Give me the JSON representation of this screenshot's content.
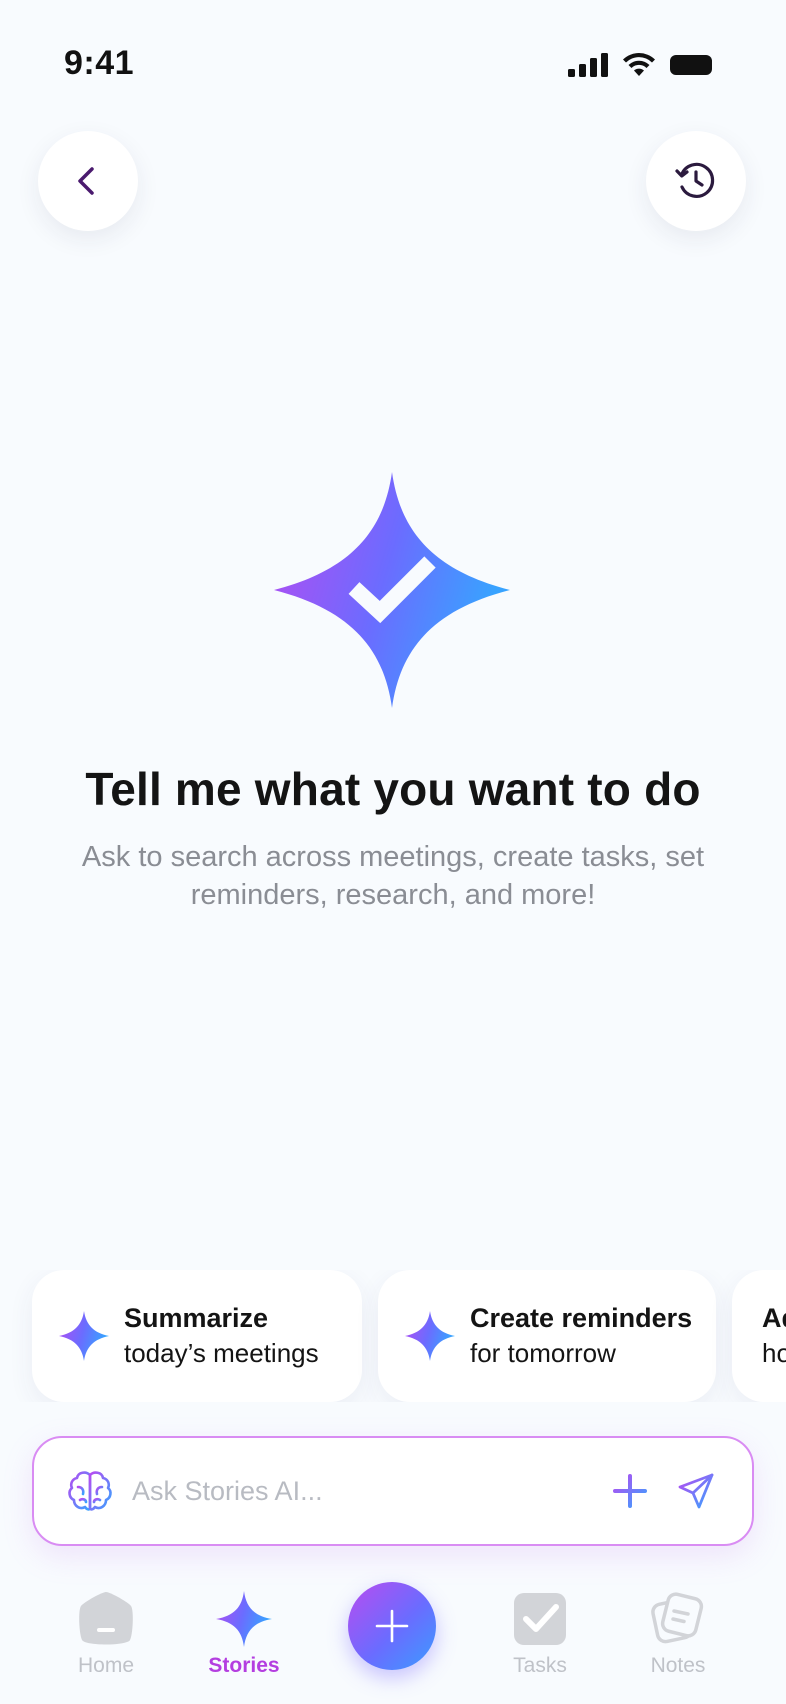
{
  "status_bar": {
    "time": "9:41"
  },
  "header": {
    "back_icon": "chevron-left-icon",
    "history_icon": "history-clock-icon"
  },
  "hero": {
    "logo_icon": "sparkle-check-icon",
    "headline": "Tell me what you want to do",
    "subtext": "Ask to search across meetings, create tasks, set reminders, research, and more!"
  },
  "suggestions": [
    {
      "title": "Summarize",
      "subtitle": "today’s meetings",
      "icon": "sparkle-icon"
    },
    {
      "title": "Create reminders",
      "subtitle": "for tomorrow",
      "icon": "sparkle-icon"
    },
    {
      "title": "Ad",
      "subtitle": "ho",
      "icon": ""
    }
  ],
  "ask_bar": {
    "placeholder": "Ask Stories AI...",
    "icons": [
      "brain-icon",
      "plus-icon",
      "send-icon"
    ]
  },
  "tabbar": {
    "items": [
      {
        "label": "Home",
        "icon": "home-icon",
        "active": false
      },
      {
        "label": "Stories",
        "icon": "sparkle-icon",
        "active": true
      },
      {
        "label": "Tasks",
        "icon": "checkbox-icon",
        "active": false
      },
      {
        "label": "Notes",
        "icon": "notes-icon",
        "active": false
      }
    ],
    "fab_icon": "plus-icon"
  },
  "colors": {
    "background": "#f8fbfe",
    "accent_purple": "#b43ee0",
    "accent_blue": "#3b9cff",
    "back_arrow": "#4a1a6e",
    "inactive": "#bfc2c8"
  }
}
